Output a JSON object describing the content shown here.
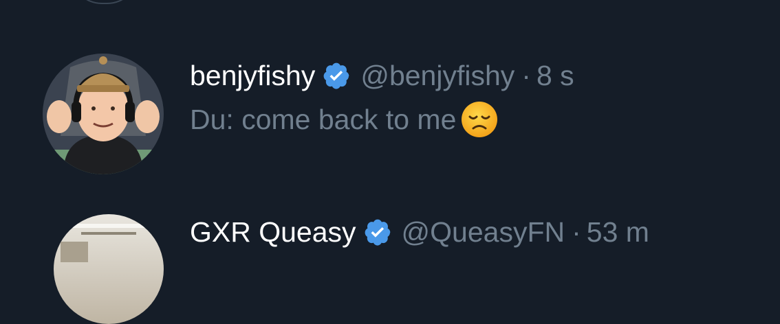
{
  "tweets": [
    {
      "display_name": "benjyfishy",
      "handle": "@benjyfishy",
      "separator": "·",
      "time": "8 s",
      "text": "Du: come back to me",
      "verified_color": "#4a99e9",
      "emoji": "disappointed-face"
    },
    {
      "display_name": "GXR Queasy",
      "handle": "@QueasyFN",
      "separator": "·",
      "time": "53 m",
      "verified_color": "#4a99e9"
    }
  ],
  "colors": {
    "background": "#151d28",
    "name": "#ffffff",
    "secondary_text": "#71808f"
  }
}
